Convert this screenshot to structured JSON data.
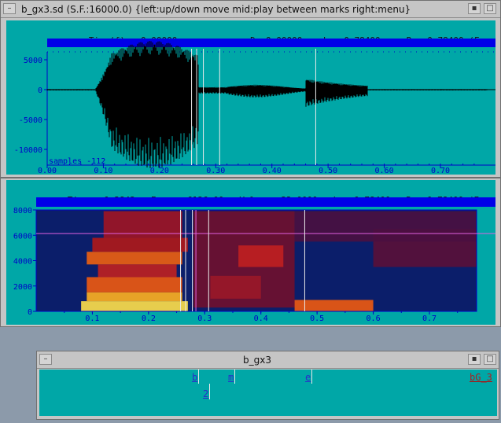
{
  "waveform_window": {
    "title": "b_gx3.sd (S.F.:16000.0) {left:up/down move  mid:play between marks  right:menu}",
    "header": {
      "time_label": "Time(f):",
      "time_value": "0.00000sec",
      "d_label": "D:",
      "d_value": "0.00000",
      "l_label": "L:",
      "l_value": "0.78400",
      "r_label": "R:",
      "r_value": "0.78400",
      "f_label": "(F:"
    },
    "samples_readout": "samples  -112",
    "y_ticks": [
      "5000",
      "0",
      "-5000",
      "-10000"
    ],
    "x_ticks": [
      "0.00",
      "0.10",
      "0.20",
      "0.30",
      "0.40",
      "0.50",
      "0.60",
      "0.70"
    ]
  },
  "spectrogram_window": {
    "header": {
      "time_label": "Time:",
      "time_value": "0.2843",
      "freq_label": "Freq:",
      "freq_value": "6136.00",
      "value_label": "Value:",
      "value_value": "32 0000",
      "l_label": "L:",
      "l_value": "0.78400",
      "r_label": "R:",
      "r_value": "0.78400",
      "f_label": "(F:"
    },
    "y_ticks": [
      "8000",
      "6000",
      "4000",
      "2000",
      "0"
    ],
    "x_ticks": [
      "0.1",
      "0.2",
      "0.3",
      "0.4",
      "0.5",
      "0.6",
      "0.7"
    ]
  },
  "label_window": {
    "title": "b_gx3",
    "labels": [
      {
        "text": "b",
        "time": 0.269
      },
      {
        "text": "m",
        "time": 0.323
      },
      {
        "text": "e",
        "time": 0.467
      },
      {
        "text": "2",
        "time": 0.287
      },
      {
        "text": "bG_3",
        "time": 0.784
      }
    ]
  },
  "colors": {
    "pane_bg": "#00a7a7",
    "header_bar": "#0000e8",
    "axis": "#0000c8",
    "chrome": "#c5c5c5"
  }
}
